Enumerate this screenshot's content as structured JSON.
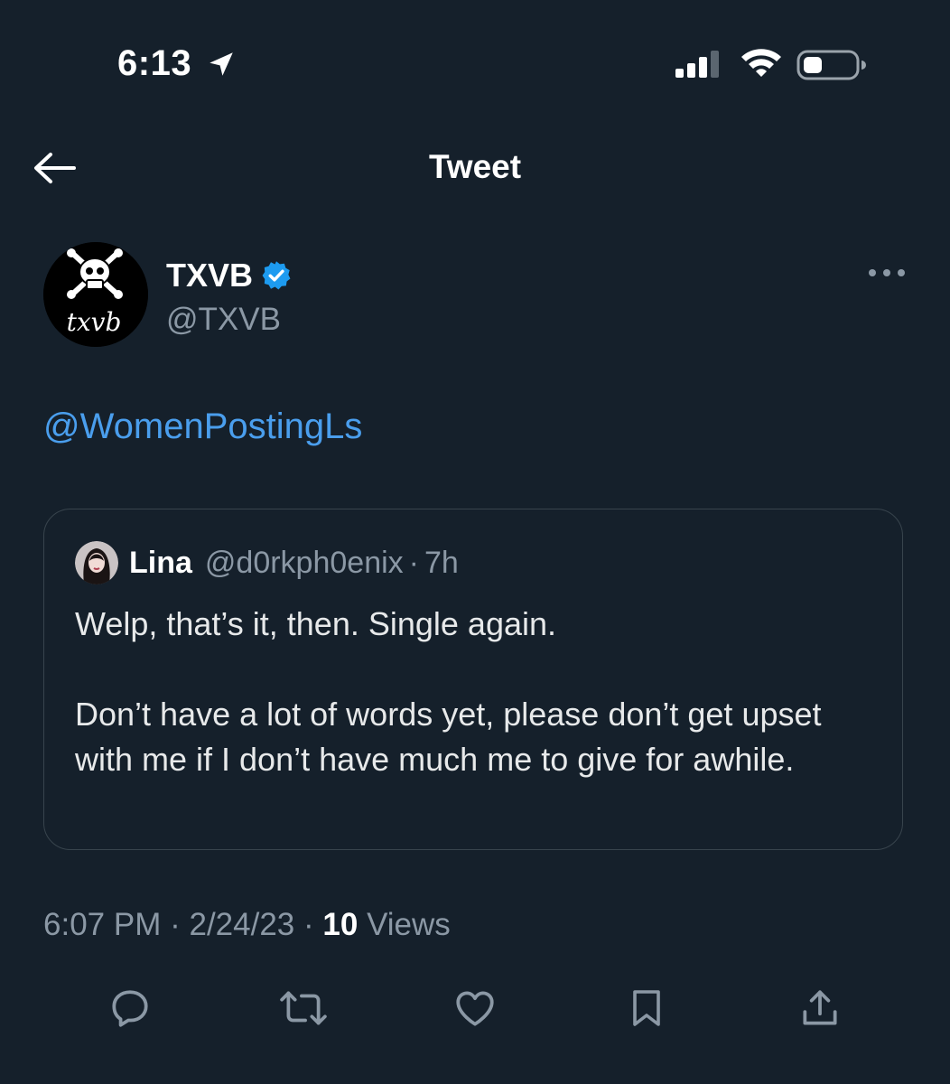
{
  "status_bar": {
    "time": "6:13",
    "icons": [
      "location-arrow-icon",
      "cellular-signal-icon",
      "wifi-icon",
      "battery-icon"
    ]
  },
  "nav": {
    "title": "Tweet",
    "back_icon": "back-arrow-icon"
  },
  "tweet": {
    "author": {
      "name": "TXVB",
      "handle": "@TXVB",
      "verified": true,
      "verified_color": "#1d9bf0",
      "avatar_text": "txvb"
    },
    "more_icon": "more-dots-icon",
    "text": "@WomenPostingLs",
    "mention_color": "#4a9eed",
    "quote": {
      "name": "Lina",
      "handle": "@d0rkph0enix",
      "separator": "·",
      "time": "7h",
      "paragraphs": [
        "Welp, that’s it, then. Single again.",
        "Don’t have a lot of words yet, please don’t get upset with me if I don’t have much me to give for awhile."
      ]
    },
    "meta": {
      "time": "6:07 PM",
      "sep1": "·",
      "date": "2/24/23",
      "sep2": "·",
      "views_count": "10",
      "views_label": "Views"
    },
    "actions": [
      "reply-icon",
      "retweet-icon",
      "like-icon",
      "bookmark-icon",
      "share-icon"
    ]
  },
  "colors": {
    "background": "#15202b",
    "secondary_text": "#8b98a5",
    "border": "#38444d"
  }
}
